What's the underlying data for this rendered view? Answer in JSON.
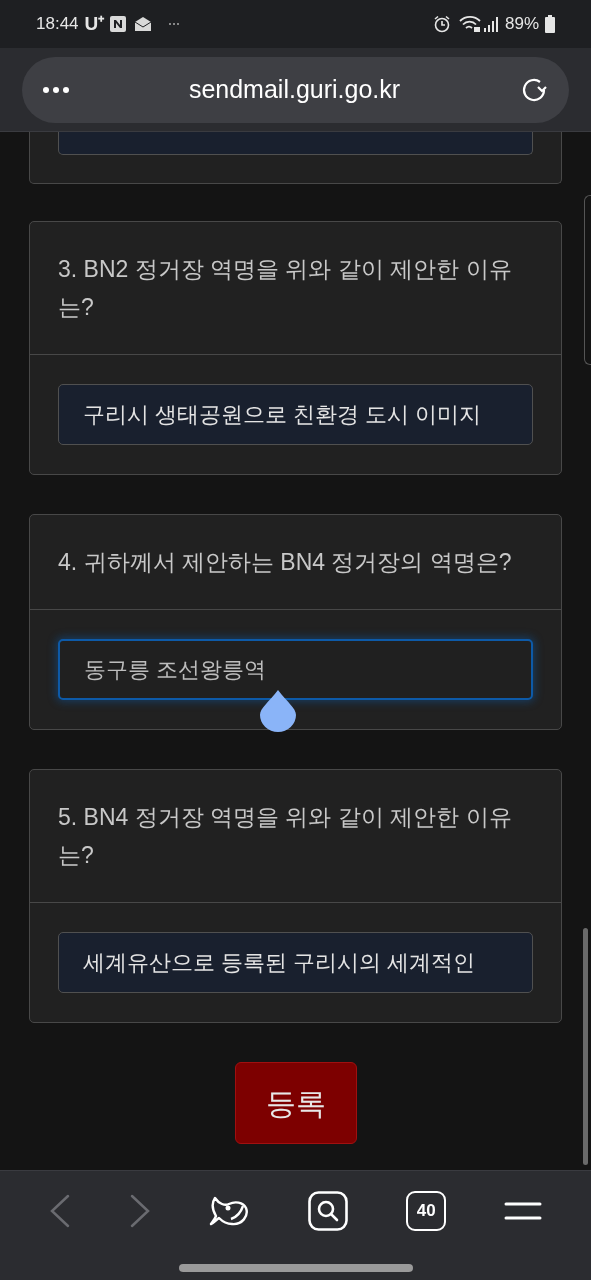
{
  "status_bar": {
    "time": "18:44",
    "carrier": "U⁺",
    "battery": "89%"
  },
  "address_bar": {
    "url": "sendmail.guri.go.kr"
  },
  "questions": [
    {
      "question": "3. BN2 정거장 역명을 위와 같이 제안한 이유는?",
      "answer": "구리시 생태공원으로 친환경 도시 이미지",
      "focused": false
    },
    {
      "question": "4. 귀하께서 제안하는 BN4 정거장의 역명은?",
      "answer": "동구릉 조선왕릉역",
      "focused": true
    },
    {
      "question": "5. BN4 정거장 역명을 위와 같이 제안한 이유는?",
      "answer": "세계유산으로 등록된 구리시의 세계적인",
      "focused": false
    }
  ],
  "submit_button": "등록",
  "bottom_nav": {
    "back_disabled": true,
    "forward_disabled": true,
    "tab_count": "40"
  }
}
